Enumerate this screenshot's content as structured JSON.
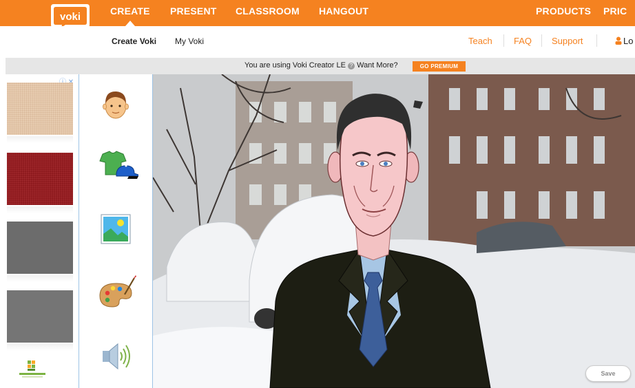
{
  "brand": {
    "logo_text": "voki",
    "color": "#f58220"
  },
  "topnav": {
    "items": [
      "CREATE",
      "PRESENT",
      "CLASSROOM",
      "HANGOUT"
    ],
    "right_items": [
      "PRODUCTS",
      "PRIC"
    ]
  },
  "subnav": {
    "items": [
      "Create Voki",
      "My Voki"
    ],
    "right_items": [
      "Teach",
      "FAQ",
      "Support"
    ],
    "login_label": "Lo"
  },
  "notice": {
    "text": "You are using Voki Creator LE",
    "more": "Want More?",
    "premium_label": "GO PREMIUM"
  },
  "tools": [
    {
      "name": "character-icon"
    },
    {
      "name": "clothing-icon"
    },
    {
      "name": "background-icon"
    },
    {
      "name": "color-palette-icon"
    },
    {
      "name": "voice-icon"
    }
  ],
  "ads": {
    "close_label": "ⓘ ✕"
  },
  "stage": {
    "save_label": "Save"
  }
}
